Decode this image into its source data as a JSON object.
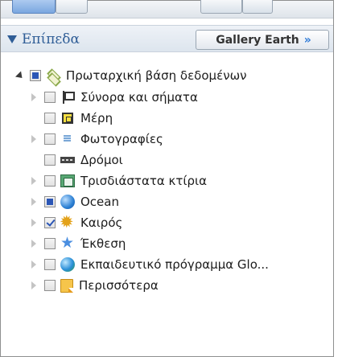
{
  "panel": {
    "title": "Επίπεδα",
    "gallery_button": "Gallery Earth",
    "gallery_chevron": "»"
  },
  "tree": {
    "root": {
      "label": "Πρωταρχική βάση δεδομένων",
      "icon": "layers-icon",
      "check_state": "partial",
      "expanded": true
    },
    "items": [
      {
        "label": "Σύνορα και σήματα",
        "icon": "flag-icon",
        "check_state": "unchecked",
        "has_children": true
      },
      {
        "label": "Μέρη",
        "icon": "places-icon",
        "check_state": "unchecked",
        "has_children": false
      },
      {
        "label": "Φωτογραφίες",
        "icon": "photo-icon",
        "check_state": "unchecked",
        "has_children": true
      },
      {
        "label": "Δρόμοι",
        "icon": "roads-icon",
        "check_state": "unchecked",
        "has_children": false
      },
      {
        "label": "Τρισδιάστατα κτίρια",
        "icon": "buildings-icon",
        "check_state": "unchecked",
        "has_children": true
      },
      {
        "label": "Ocean",
        "icon": "globe-icon",
        "check_state": "partial",
        "has_children": true
      },
      {
        "label": "Καιρός",
        "icon": "weather-icon",
        "check_state": "checked",
        "has_children": true
      },
      {
        "label": "Έκθεση",
        "icon": "star-icon",
        "check_state": "unchecked",
        "has_children": true
      },
      {
        "label": "Εκπαιδευτικό πρόγραμμα Glo...",
        "icon": "globe-green-icon",
        "check_state": "unchecked",
        "has_children": true
      },
      {
        "label": "Περισσότερα",
        "icon": "folder-icon",
        "check_state": "unchecked",
        "has_children": true
      }
    ]
  }
}
